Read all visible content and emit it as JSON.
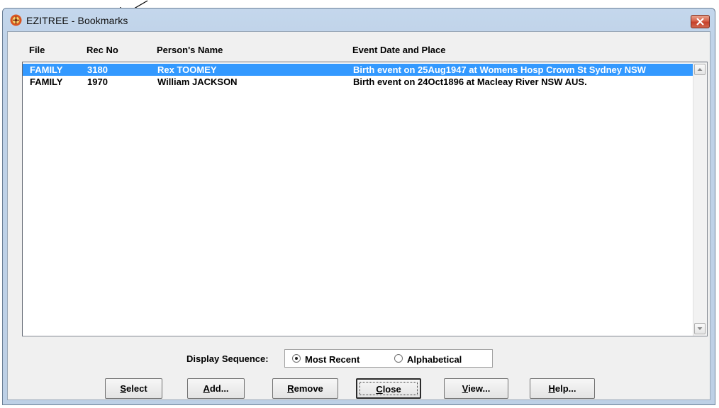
{
  "window": {
    "title": "EZITREE - Bookmarks"
  },
  "columns": [
    "File",
    "Rec No",
    "Person's Name",
    "Event Date and Place"
  ],
  "rows": [
    {
      "file": "FAMILY",
      "rec_no": "3180",
      "name": "Rex TOOMEY",
      "event": "Birth event on 25Aug1947 at Womens Hosp Crown St Sydney NSW",
      "selected": true
    },
    {
      "file": "FAMILY",
      "rec_no": "1970",
      "name": "William JACKSON",
      "event": "Birth event on 24Oct1896 at Macleay River NSW AUS.",
      "selected": false
    }
  ],
  "display_sequence": {
    "label": "Display Sequence:",
    "options": [
      "Most Recent",
      "Alphabetical"
    ],
    "selected": "Most Recent"
  },
  "buttons": {
    "select": {
      "key": "S",
      "rest": "elect"
    },
    "add": {
      "key": "A",
      "rest": "dd..."
    },
    "remove": {
      "key": "R",
      "rest": "emove"
    },
    "close": {
      "key": "C",
      "rest": "lose"
    },
    "view": {
      "key": "V",
      "rest": "iew..."
    },
    "help": {
      "key": "H",
      "rest": "elp..."
    }
  },
  "colors": {
    "selection": "#3399ff",
    "titlebar": "#c4d7ec",
    "close_button": "#c6402a"
  },
  "icons": [
    "annotation-arrow-icon",
    "ezitree-app-icon",
    "close-icon",
    "scroll-up-icon",
    "scroll-down-icon"
  ]
}
